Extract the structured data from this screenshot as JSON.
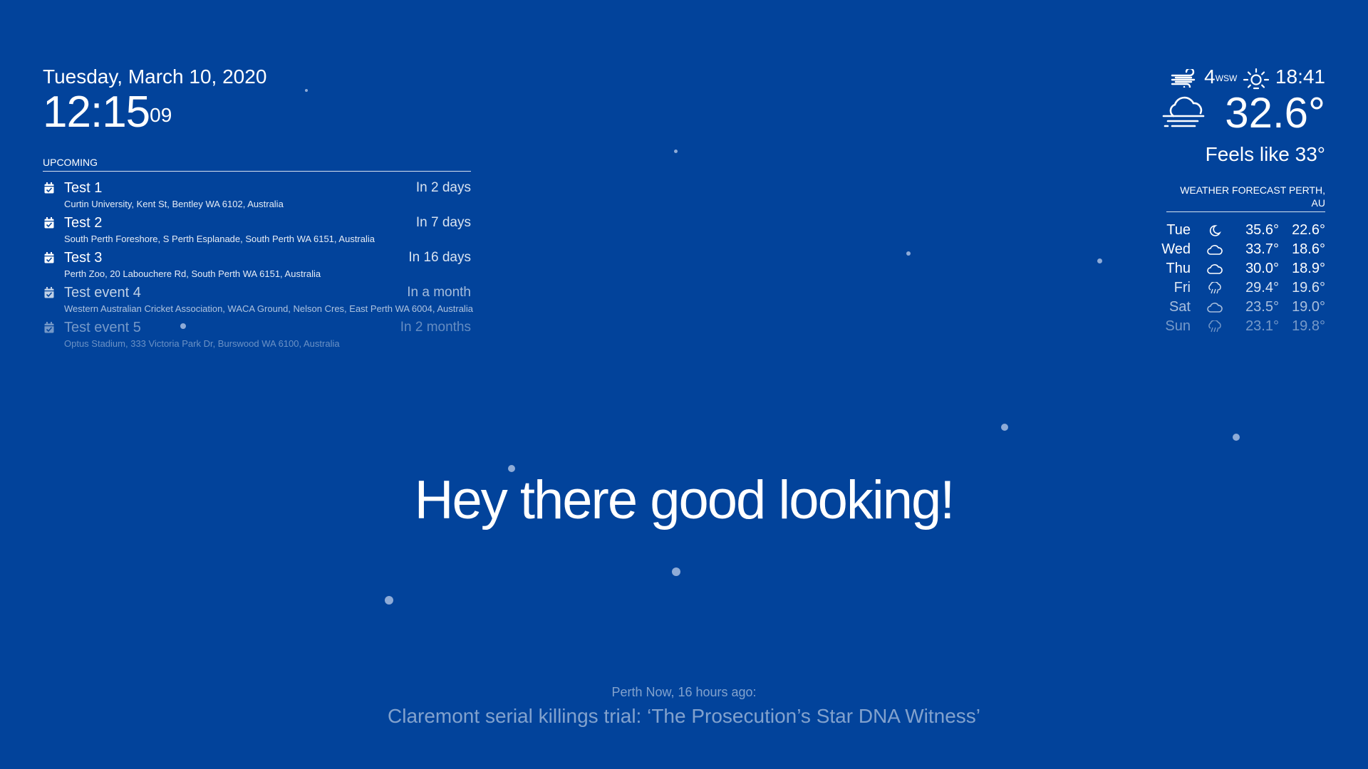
{
  "clock": {
    "date": "Tuesday, March 10, 2020",
    "time": "12:15",
    "seconds": "09"
  },
  "calendar": {
    "header": "UPCOMING",
    "events": [
      {
        "title": "Test 1",
        "time": "In 2 days",
        "location": "Curtin University, Kent St, Bentley WA 6102, Australia",
        "opacity": 1.0
      },
      {
        "title": "Test 2",
        "time": "In 7 days",
        "location": "South Perth Foreshore, S Perth Esplanade, South Perth WA 6151, Australia",
        "opacity": 1.0
      },
      {
        "title": "Test 3",
        "time": "In 16 days",
        "location": "Perth Zoo, 20 Labouchere Rd, South Perth WA 6151, Australia",
        "opacity": 1.0
      },
      {
        "title": "Test event 4",
        "time": "In a month",
        "location": "Western Australian Cricket Association, WACA Ground, Nelson Cres, East Perth WA 6004, Australia",
        "opacity": 0.75
      },
      {
        "title": "Test event 5",
        "time": "In 2 months",
        "location": "Optus Stadium, 333 Victoria Park Dr, Burswood WA 6100, Australia",
        "opacity": 0.45
      }
    ],
    "icon": "calendar-check-icon"
  },
  "current_weather": {
    "wind_icon": "wind-icon",
    "wind_speed": "4",
    "wind_direction": "WSW",
    "sunset_icon": "sunset-icon",
    "sunset_time": "18:41",
    "condition_icon": "cloudy-windy-icon",
    "temperature": "32.6°",
    "feels_like": "Feels like 33°"
  },
  "forecast": {
    "header": "WEATHER FORECAST PERTH, AU",
    "days": [
      {
        "day": "Tue",
        "icon": "moon-icon",
        "max": "35.6°",
        "min": "22.6°",
        "opacity": 1.0
      },
      {
        "day": "Wed",
        "icon": "cloud-icon",
        "max": "33.7°",
        "min": "18.6°",
        "opacity": 1.0
      },
      {
        "day": "Thu",
        "icon": "cloud-icon",
        "max": "30.0°",
        "min": "18.9°",
        "opacity": 1.0
      },
      {
        "day": "Fri",
        "icon": "rain-cloud-icon",
        "max": "29.4°",
        "min": "19.6°",
        "opacity": 0.85
      },
      {
        "day": "Sat",
        "icon": "cloud-icon",
        "max": "23.5°",
        "min": "19.0°",
        "opacity": 0.65
      },
      {
        "day": "Sun",
        "icon": "rain-cloud-icon",
        "max": "23.1°",
        "min": "19.8°",
        "opacity": 0.45
      }
    ]
  },
  "compliment": {
    "text": "Hey there good looking!"
  },
  "news": {
    "source": "Perth Now, 16 hours ago:",
    "headline": "Claremont serial killings trial: ‘The Prosecution’s Star DNA Witness’"
  },
  "colors": {
    "background": "#02439b",
    "text": "#ffffff",
    "snow": "#becdeb"
  }
}
